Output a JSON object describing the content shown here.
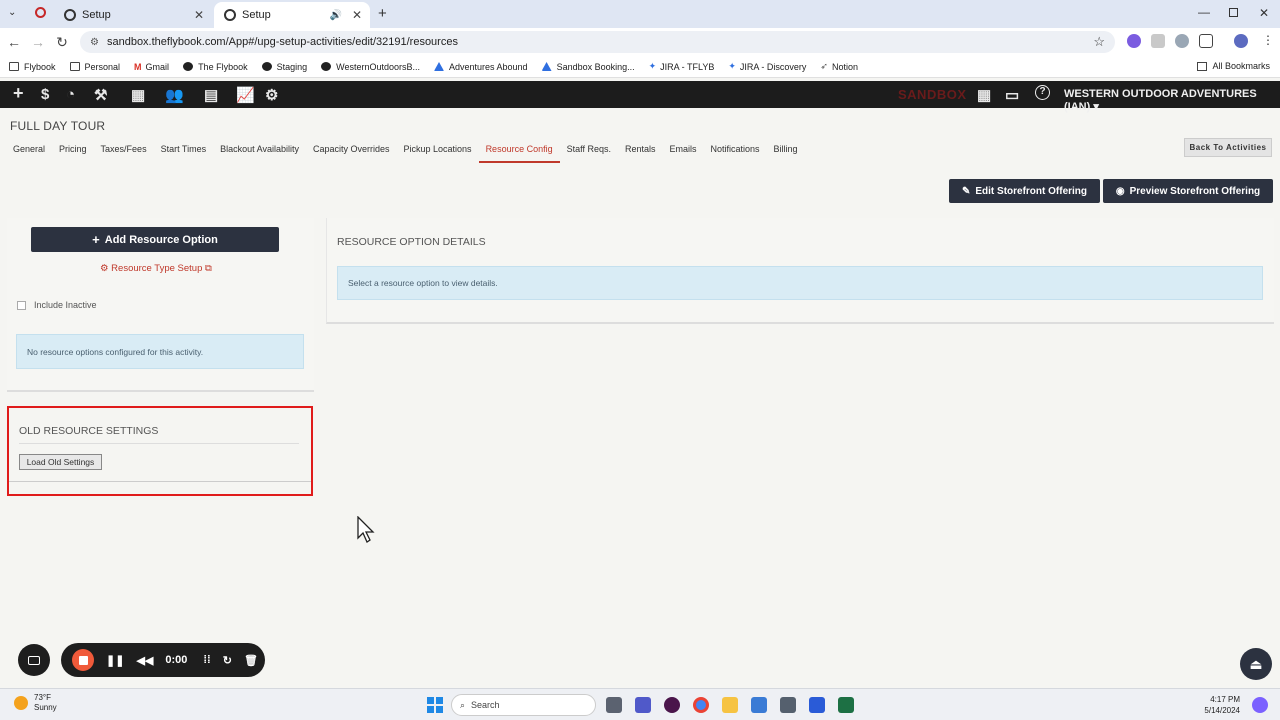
{
  "browser": {
    "tabs": [
      {
        "title": "Setup",
        "active": false
      },
      {
        "title": "Setup",
        "active": true
      }
    ],
    "url": "sandbox.theflybook.com/App#/upg-setup-activities/edit/32191/resources",
    "bookmarks": [
      "Flybook",
      "Personal",
      "Gmail",
      "The Flybook",
      "Staging",
      "WesternOutdoorsB...",
      "Adventures Abound",
      "Sandbox Booking...",
      "JIRA - TFLYB",
      "JIRA - Discovery",
      "Notion"
    ],
    "all_bookmarks": "All Bookmarks"
  },
  "app": {
    "sandbox_label": "SANDBOX",
    "company": "WESTERN OUTDOOR ADVENTURES (IAN)"
  },
  "page": {
    "title": "FULL DAY TOUR",
    "tabs": [
      "General",
      "Pricing",
      "Taxes/Fees",
      "Start Times",
      "Blackout Availability",
      "Capacity Overrides",
      "Pickup Locations",
      "Resource Config",
      "Staff Reqs.",
      "Rentals",
      "Emails",
      "Notifications",
      "Billing"
    ],
    "active_tab": "Resource Config",
    "back_button": "Back To Activities",
    "edit_storefront": "Edit Storefront Offering",
    "preview_storefront": "Preview Storefront Offering"
  },
  "left": {
    "add_button": "Add Resource Option",
    "type_setup": "Resource Type Setup",
    "include_inactive": "Include Inactive",
    "empty_msg": "No resource options configured for this activity."
  },
  "details": {
    "title": "RESOURCE OPTION DETAILS",
    "msg": "Select a resource option to view details."
  },
  "old_settings": {
    "title": "OLD RESOURCE SETTINGS",
    "button": "Load Old Settings"
  },
  "recorder": {
    "time": "0:00"
  },
  "taskbar": {
    "temp": "73°F",
    "condition": "Sunny",
    "search_placeholder": "Search",
    "time": "4:17 PM",
    "date": "5/14/2024"
  },
  "colors": {
    "accent": "#c0392b",
    "dark_button": "#2c3240",
    "highlight": "#e01b1b"
  }
}
